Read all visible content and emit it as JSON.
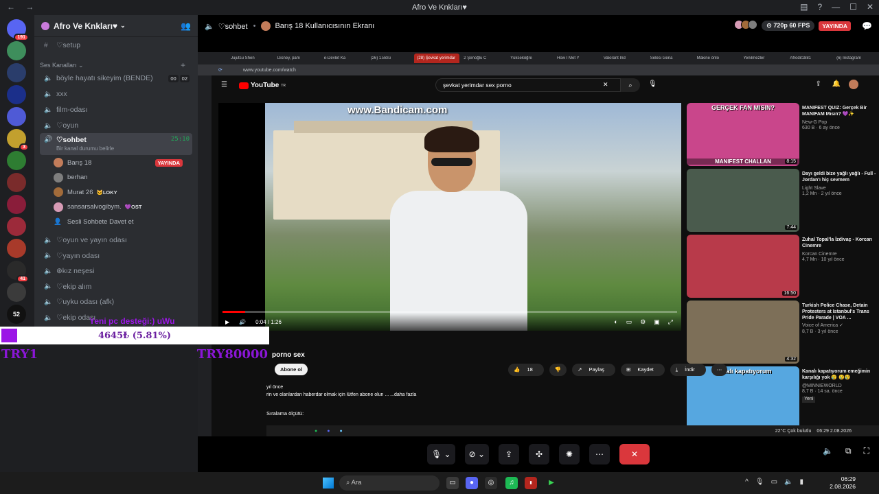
{
  "window": {
    "title": "Afro Ve Knkları♥"
  },
  "rail": {
    "items": [
      {
        "name": "direct-messages",
        "badge": "191"
      },
      {
        "name": "server-1",
        "badge": ""
      },
      {
        "name": "server-2",
        "badge": ""
      },
      {
        "name": "server-3",
        "badge": ""
      },
      {
        "name": "server-4",
        "badge": ""
      },
      {
        "name": "server-5",
        "badge": "3"
      },
      {
        "name": "server-6",
        "badge": ""
      },
      {
        "name": "server-7",
        "badge": ""
      },
      {
        "name": "server-8",
        "badge": ""
      },
      {
        "name": "server-9",
        "badge": ""
      },
      {
        "name": "server-10",
        "badge": ""
      },
      {
        "name": "server-11",
        "badge": "41"
      },
      {
        "name": "server-12",
        "badge": ""
      }
    ],
    "extra_label": "52"
  },
  "sidebar": {
    "guild_name": "Afro Ve Knkları♥",
    "setup_channel": "♡setup",
    "voice_category": "Ses Kanalları",
    "channels_top": [
      {
        "name": "böyle hayatı sikeyim (BENDE)",
        "c1": "00",
        "c2": "02"
      },
      {
        "name": "xxx"
      },
      {
        "name": "film-odası"
      },
      {
        "name": "♡oyun"
      }
    ],
    "active_channel": {
      "name": "♡sohbet",
      "timer": "25:10",
      "status": "Bir kanal durumu belirle"
    },
    "members": [
      {
        "name": "Barış 18",
        "tag": "YAYINDA",
        "color": "#c27c5a"
      },
      {
        "name": "berhan",
        "tag": "",
        "color": "#7e7e7e"
      },
      {
        "name": "Murat 26",
        "tag": "🐱LOKY",
        "color": "#a26b3a"
      },
      {
        "name": "sansarsalvogibym.",
        "tag": "💜OST",
        "color": "#d79bb5"
      }
    ],
    "invite_label": "Sesli Sohbete Davet et",
    "channels_bottom": [
      {
        "name": "♡oyun ve yayın odası"
      },
      {
        "name": "♡yayın odası"
      },
      {
        "name": "⊛kız neşesi"
      },
      {
        "name": "♡ekip alım"
      },
      {
        "name": "♡uyku odası (afk)"
      },
      {
        "name": "♡ekip odası"
      }
    ]
  },
  "header": {
    "channel": "♡sohbet",
    "stream_title": "Barış 18 Kullanıcısının Ekranı",
    "quality": "720p 60 FPS",
    "live": "YAYINDA"
  },
  "browser": {
    "tabs": [
      "Jujutsu Shen",
      "Disney, pam",
      "e-Devlet Ka",
      "(26) 1.Bölü",
      "(28) Şevkat yerimdar",
      "2 Şenoğlu C",
      "Yükseköğre",
      "How I Met Y",
      "Valorant İnd",
      "Selesi Gena",
      "Makine önlo",
      "Yenilmezler",
      "Afrodit1881",
      "(6) Instagram"
    ],
    "url": "www.youtube.com/watch",
    "yt_logo": "YouTube",
    "yt_logo_sup": "TR",
    "search_query": "şevkat yerimdar sex porno",
    "watermark": "www.Bandicam.com",
    "time": "0:04 / 1:26",
    "progress": 0.05,
    "title_visible": "porno sex",
    "subscribe": "Abone ol",
    "likes": "18",
    "share": "Paylaş",
    "save": "Kaydet",
    "download": "İndir",
    "desc_line1": "yıl önce",
    "desc_line2": "rin ve olanlardan haberdar olmak için lütfen abone olun ... ...daha fazla",
    "sort_label": "Sıralama ölçütü:",
    "weather": "22°C Çok bulutlu",
    "inner_time": "06:29",
    "inner_date": "2.08.2026"
  },
  "recommendations": [
    {
      "title": "MANIFEST QUIZ: Gerçek Bir MANIFAM Mısın? 💜✨",
      "channel": "New-G Pop",
      "meta": "630 B · 6 ay önce",
      "duration": "8:15",
      "thumb_text_top": "GERÇEK FAN MISIN?",
      "thumb_text_bottom": "MANIFEST CHALLAN",
      "color": "#c9468b"
    },
    {
      "title": "Dayı geldi bize yağlı yağlı - Full - Jordan'ı hiç sevmem",
      "channel": "Light Slave",
      "meta": "1,2 Mn · 2 yıl önce",
      "duration": "7:44",
      "color": "#4a5b4d"
    },
    {
      "title": "Zuhal Topal'la İzdivaç - Korcan Cinemre",
      "channel": "Korcan Cinemre",
      "meta": "4,7 Mn · 10 yıl önce",
      "duration": "16:50",
      "color": "#b83a4a"
    },
    {
      "title": "Turkish Police Chase, Detain Protesters at Istanbul's Trans Pride Parade | VOA ...",
      "channel": "Voice of America ✓",
      "meta": "8,7 B · 3 yıl önce",
      "duration": "4:32",
      "color": "#7d6f58"
    },
    {
      "title": "Kanalı kapatıyorum emeğimin karşılığı yok 😢 😢😢",
      "channel": "@MINNIEWORLD",
      "meta": "8,7 B · 14 sa. önce",
      "duration": "",
      "badge": "Yeni",
      "thumb_text_top": "Kanalı kapatıyorum",
      "color": "#56a7e0"
    }
  ],
  "taskbar": {
    "search": "Ara",
    "time": "06:29",
    "date": "2.08.2026"
  },
  "overlay": {
    "goal_text": "Yeni pc desteği:) uWu",
    "amount": "4645₺ (5.81%)",
    "progress": 0.0581,
    "min": "TRY1",
    "max": "TRY80000"
  }
}
